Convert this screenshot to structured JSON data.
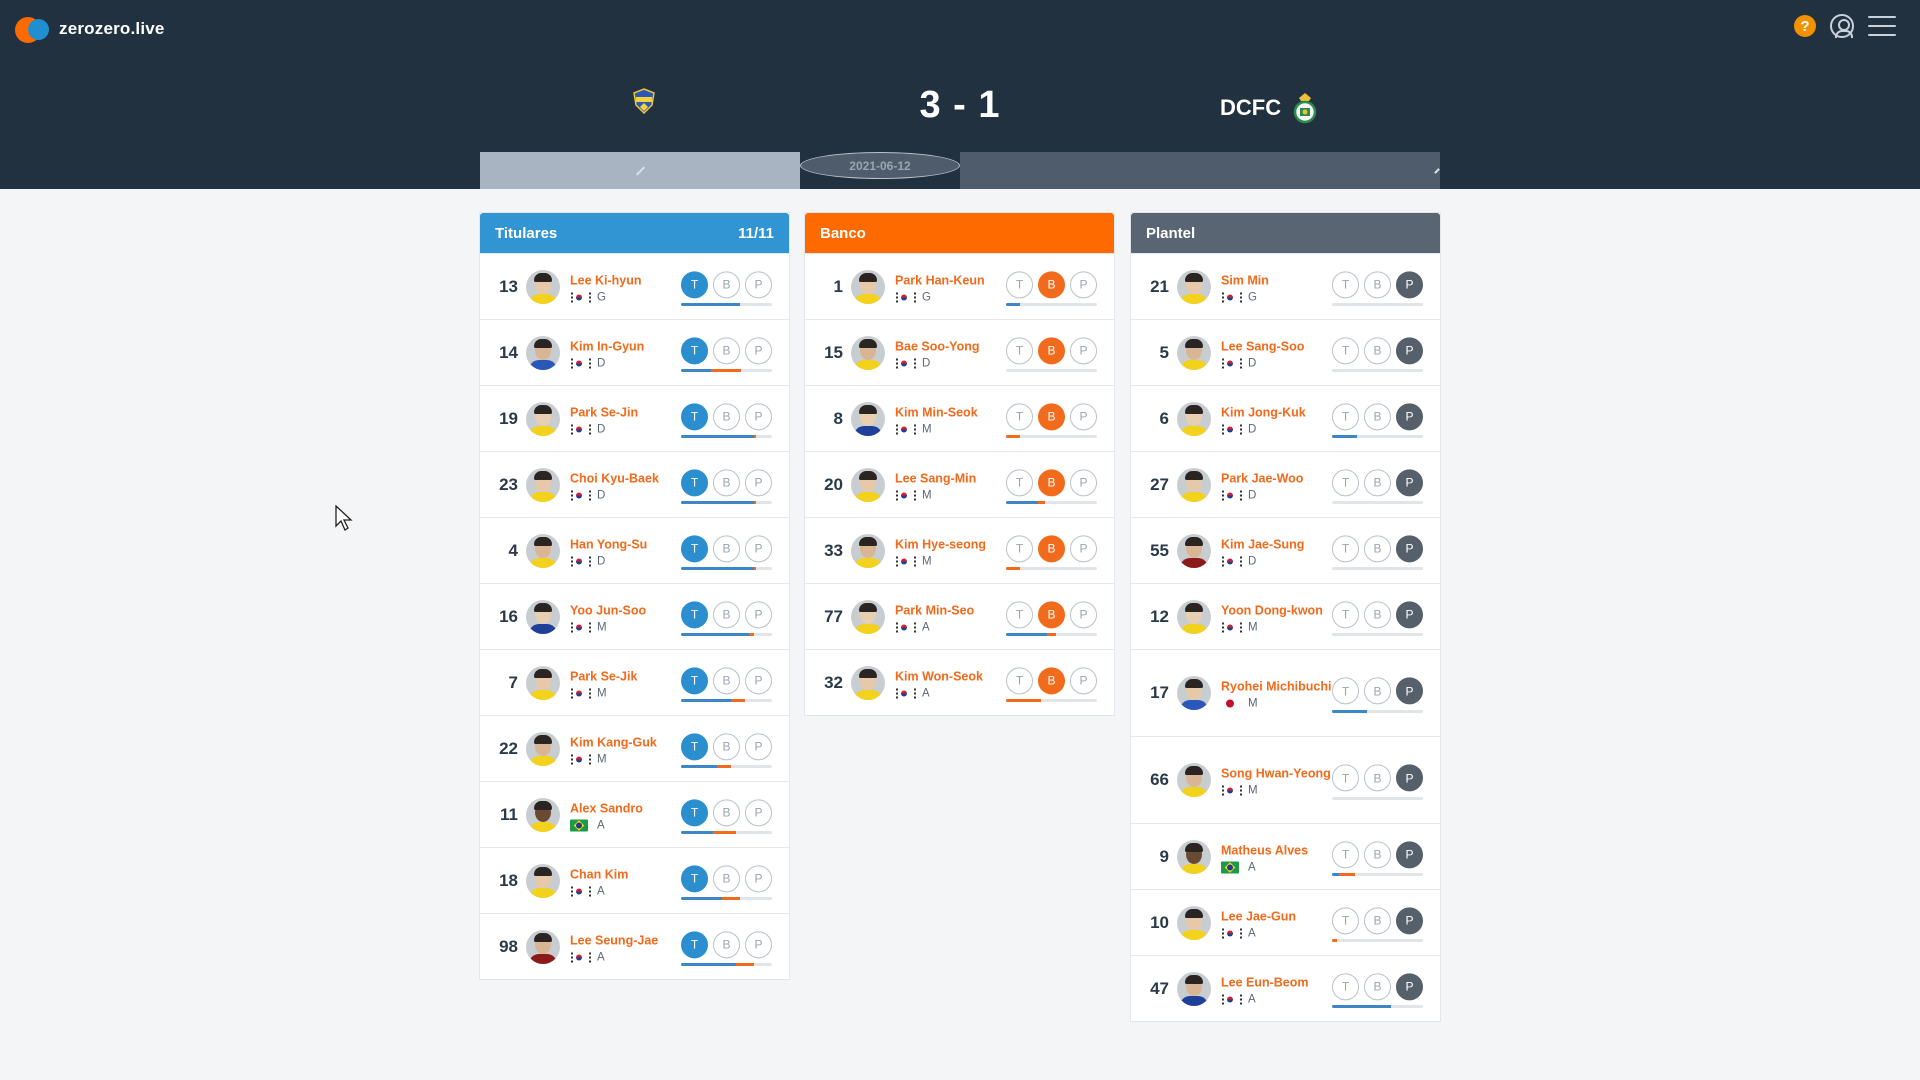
{
  "header": {
    "brand": "zerozero.live",
    "icons": [
      "help-icon",
      "user-icon",
      "menu-icon"
    ],
    "colors": {
      "bg": "#223140",
      "orange": "#f26a1b",
      "blue": "#2b8fcf"
    }
  },
  "match": {
    "score": "3 - 1",
    "away_team": "DCFC",
    "date": "2021-06-12"
  },
  "columns": [
    {
      "key": "titulares",
      "title": "Titulares",
      "count": "11/11",
      "color": "#3195d3",
      "state": "T",
      "players": [
        {
          "number": "13",
          "name": "Lee Ki-hyun",
          "nation": "kr",
          "pos": "G",
          "bar": [
            0.65,
            0.0
          ]
        },
        {
          "number": "14",
          "name": "Kim In-Gyun",
          "nation": "kr",
          "pos": "D",
          "bar": [
            0.33,
            0.33
          ]
        },
        {
          "number": "19",
          "name": "Park Se-Jin",
          "nation": "kr",
          "pos": "D",
          "bar": [
            0.8,
            0.02
          ]
        },
        {
          "number": "23",
          "name": "Choi Kyu-Baek",
          "nation": "kr",
          "pos": "D",
          "bar": [
            0.8,
            0.02
          ]
        },
        {
          "number": "4",
          "name": "Han Yong-Su",
          "nation": "kr",
          "pos": "D",
          "bar": [
            0.8,
            0.02
          ]
        },
        {
          "number": "16",
          "name": "Yoo Jun-Soo",
          "nation": "kr",
          "pos": "M",
          "bar": [
            0.75,
            0.05
          ]
        },
        {
          "number": "7",
          "name": "Park Se-Jik",
          "nation": "kr",
          "pos": "M",
          "bar": [
            0.55,
            0.15
          ]
        },
        {
          "number": "22",
          "name": "Kim Kang-Guk",
          "nation": "kr",
          "pos": "M",
          "bar": [
            0.4,
            0.15
          ]
        },
        {
          "number": "11",
          "name": "Alex Sandro",
          "nation": "br",
          "pos": "A",
          "bar": [
            0.35,
            0.25
          ]
        },
        {
          "number": "18",
          "name": "Chan Kim",
          "nation": "kr",
          "pos": "A",
          "bar": [
            0.45,
            0.2
          ]
        },
        {
          "number": "98",
          "name": "Lee Seung-Jae",
          "nation": "kr",
          "pos": "A",
          "bar": [
            0.6,
            0.2
          ]
        }
      ]
    },
    {
      "key": "banco",
      "title": "Banco",
      "count": "",
      "color": "#ff6a00",
      "state": "B",
      "players": [
        {
          "number": "1",
          "name": "Park Han-Keun",
          "nation": "kr",
          "pos": "G",
          "bar": [
            0.15,
            0.0
          ]
        },
        {
          "number": "15",
          "name": "Bae Soo-Yong",
          "nation": "kr",
          "pos": "D",
          "bar": [
            0.0,
            0.0
          ]
        },
        {
          "number": "8",
          "name": "Kim Min-Seok",
          "nation": "kr",
          "pos": "M",
          "bar": [
            0.0,
            0.15
          ]
        },
        {
          "number": "20",
          "name": "Lee Sang-Min",
          "nation": "kr",
          "pos": "M",
          "bar": [
            0.35,
            0.08
          ]
        },
        {
          "number": "33",
          "name": "Kim Hye-seong",
          "nation": "kr",
          "pos": "M",
          "bar": [
            0.0,
            0.15
          ]
        },
        {
          "number": "77",
          "name": "Park Min-Seo",
          "nation": "kr",
          "pos": "A",
          "bar": [
            0.45,
            0.1
          ]
        },
        {
          "number": "32",
          "name": "Kim Won-Seok",
          "nation": "kr",
          "pos": "A",
          "bar": [
            0.0,
            0.38
          ]
        }
      ]
    },
    {
      "key": "plantel",
      "title": "Plantel",
      "count": "",
      "color": "#5a6573",
      "state": "P",
      "players": [
        {
          "number": "21",
          "name": "Sim Min",
          "nation": "kr",
          "pos": "G",
          "bar": [
            0.0,
            0.0
          ]
        },
        {
          "number": "5",
          "name": "Lee Sang-Soo",
          "nation": "kr",
          "pos": "D",
          "bar": [
            0.0,
            0.0
          ]
        },
        {
          "number": "6",
          "name": "Kim Jong-Kuk",
          "nation": "kr",
          "pos": "D",
          "bar": [
            0.28,
            0.0
          ]
        },
        {
          "number": "27",
          "name": "Park Jae-Woo",
          "nation": "kr",
          "pos": "D",
          "bar": [
            0.0,
            0.0
          ]
        },
        {
          "number": "55",
          "name": "Kim Jae-Sung",
          "nation": "kr",
          "pos": "D",
          "bar": [
            0.0,
            0.0
          ]
        },
        {
          "number": "12",
          "name": "Yoon Dong-kwon",
          "nation": "kr",
          "pos": "M",
          "bar": [
            0.0,
            0.0
          ]
        },
        {
          "number": "17",
          "name": "Ryohei Michibuchi",
          "nation": "jp",
          "pos": "M",
          "bar": [
            0.38,
            0.0
          ]
        },
        {
          "number": "66",
          "name": "Song Hwan-Yeong",
          "nation": "kr",
          "pos": "M",
          "bar": [
            0.0,
            0.0
          ]
        },
        {
          "number": "9",
          "name": "Matheus Alves",
          "nation": "br",
          "pos": "A",
          "bar": [
            0.08,
            0.18
          ]
        },
        {
          "number": "10",
          "name": "Lee Jae-Gun",
          "nation": "kr",
          "pos": "A",
          "bar": [
            0.0,
            0.05
          ]
        },
        {
          "number": "47",
          "name": "Lee Eun-Beom",
          "nation": "kr",
          "pos": "A",
          "bar": [
            0.65,
            0.0
          ]
        }
      ]
    }
  ]
}
